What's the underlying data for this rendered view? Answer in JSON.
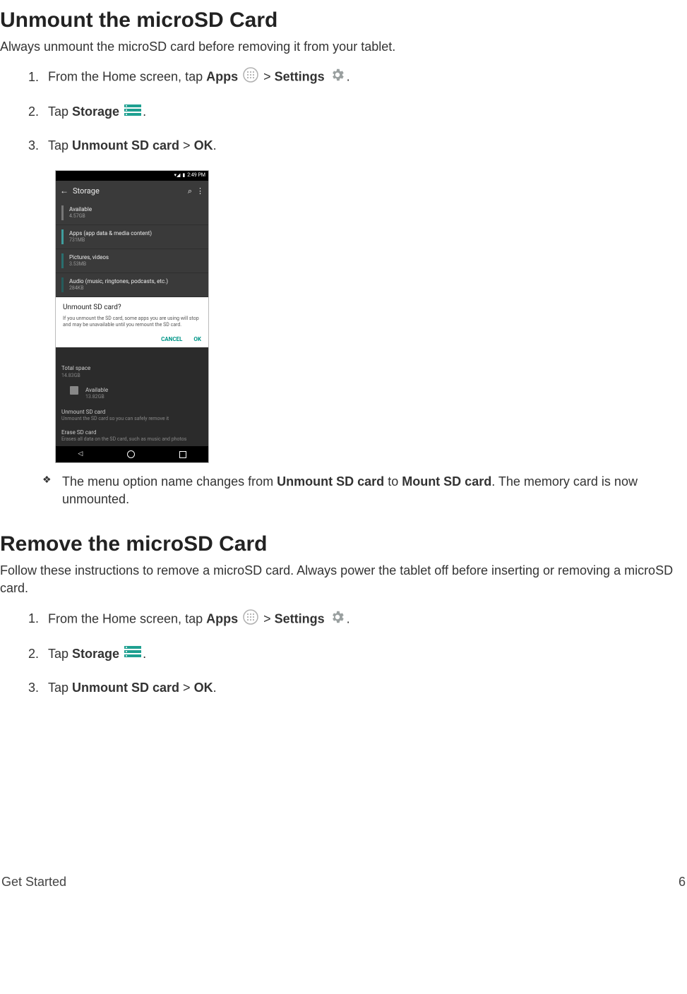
{
  "section1": {
    "heading": "Unmount the microSD Card",
    "intro": "Always unmount the microSD card before removing it from your tablet.",
    "steps": {
      "s1a": "From the Home screen, tap ",
      "s1_apps": "Apps",
      "s1_gt": " > ",
      "s1_settings": "Settings",
      "s1_end": ".",
      "s2a": "Tap ",
      "s2_storage": "Storage",
      "s2_end": ".",
      "s3a": "Tap ",
      "s3_unmount": "Unmount SD card",
      "s3_gt": " > ",
      "s3_ok": "OK",
      "s3_end": "."
    },
    "note_a": "The menu option name changes from ",
    "note_b": "Unmount SD card",
    "note_c": " to ",
    "note_d": "Mount SD card",
    "note_e": ". The memory card is now unmounted."
  },
  "screenshot": {
    "time": "2:49 PM",
    "appbar_title": "Storage",
    "items": [
      {
        "label": "Available",
        "sub": "4.57GB",
        "color": "#777"
      },
      {
        "label": "Apps (app data & media content)",
        "sub": "731MB",
        "color": "#3f9e9e"
      },
      {
        "label": "Pictures, videos",
        "sub": "3.53MB",
        "color": "#2a6f6f"
      },
      {
        "label": "Audio (music, ringtones, podcasts, etc.)",
        "sub": "284KB",
        "color": "#255c5c"
      }
    ],
    "dialog": {
      "title": "Unmount SD card?",
      "body": "If you unmount the SD card, some apps you are using will stop and may be unavailable until you remount the SD card.",
      "cancel": "CANCEL",
      "ok": "OK"
    },
    "total_label": "Total space",
    "total_sub": "14.83GB",
    "avail_label": "Available",
    "avail_sub": "13.82GB",
    "unmount_label": "Unmount SD card",
    "unmount_sub": "Unmount the SD card so you can safely remove it",
    "erase_label": "Erase SD card",
    "erase_sub": "Erases all data on the SD card, such as music and photos"
  },
  "section2": {
    "heading": "Remove the microSD Card",
    "intro": "Follow these instructions to remove a microSD card. Always power the tablet off before inserting or removing a microSD card.",
    "steps": {
      "s1a": "From the Home screen, tap ",
      "s1_apps": "Apps",
      "s1_gt": " > ",
      "s1_settings": "Settings",
      "s1_end": ".",
      "s2a": "Tap ",
      "s2_storage": "Storage",
      "s2_end": ".",
      "s3a": "Tap ",
      "s3_unmount": "Unmount SD card",
      "s3_gt": " > ",
      "s3_ok": "OK",
      "s3_end": "."
    }
  },
  "footer": {
    "left": "Get Started",
    "right": "6"
  }
}
